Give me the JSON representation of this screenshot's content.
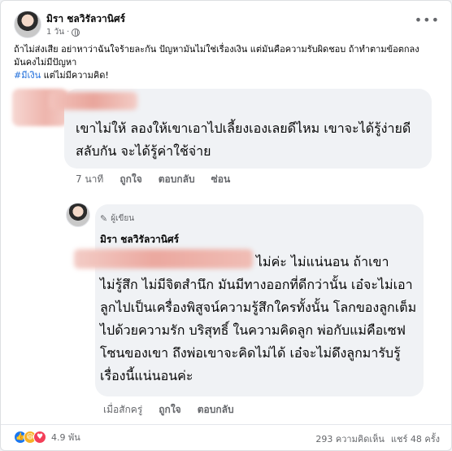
{
  "post": {
    "author": "มิรา ชลวิรัลวานิศร์",
    "time": "1 วัน ·",
    "privacy_icon": "globe-icon",
    "more_icon": "more-icon",
    "text_line1": "ถ้าไม่ส่งเสีย อย่าหาว่าฉันใจร้ายละกัน ปัญหามันไม่ใช่เรื่องเงิน แต่มันคือความรับผิดชอบ ถ้าทำตามข้อตกลง",
    "text_line2": "มันคงไม่มีปัญหา",
    "hashtag": "#มีเงิน",
    "text_line3_rest": " แต่ไม่มีความคิด!"
  },
  "comment": {
    "text": "เขาไม่ให้ ลองให้เขาเอาไปเลี้ยงเองเลยดีไหม เขาจะได้รู้ง่ายดีสลับกัน จะได้รู้ค่าใช้จ่าย",
    "time": "7 นาที",
    "like_label": "ถูกใจ",
    "reply_label": "ตอบกลับ",
    "hide_label": "ซ่อน"
  },
  "reply": {
    "badge": "ผู้เขียน",
    "author": "มิรา ชลวิรัลวานิศร์",
    "first_line": "ไม่ค่ะ ไม่แน่นอน ถ้าเขา",
    "body": "ไม่รู้สึก ไม่มีจิตสำนึก มันมีทางออกที่ดีกว่านั้น เอ๋จะไม่เอาลูกไปเป็นเครื่องพิสูจน์ความรู้สึกใครทั้งนั้น โลกของลูกเต็มไปด้วยความรัก บริสุทธิ์ ในความคิดลูก พ่อกับแม่คือเซฟโซนของเขา ถึงพ่อเขาจะคิดไม่ได้ เอ๋จะไม่ดึงลูกมารับรู้เรื่องนี้แน่นอนค่ะ",
    "time": "เมื่อสักครู่",
    "like_label": "ถูกใจ",
    "reply_label": "ตอบกลับ"
  },
  "footer": {
    "reaction_count": "4.9 พัน",
    "comments": "293 ความคิดเห็น",
    "shares": "แชร์ 48 ครั้ง",
    "reaction_icons": [
      "like-icon",
      "haha-icon",
      "love-icon"
    ]
  },
  "colors": {
    "link": "#216fdb",
    "muted": "#65676b",
    "bubble": "#f0f2f5"
  }
}
